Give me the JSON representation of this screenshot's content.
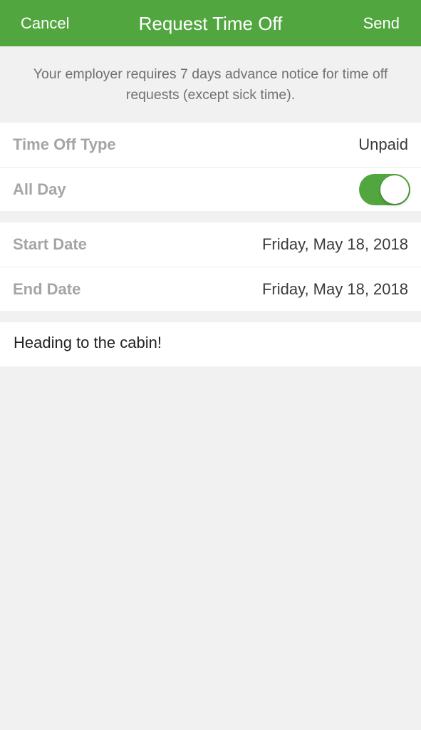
{
  "nav": {
    "cancel_label": "Cancel",
    "title": "Request Time Off",
    "send_label": "Send",
    "background_color": "#52a640"
  },
  "notice": {
    "text": "Your employer requires 7 days advance notice for time off requests (except sick time)."
  },
  "details": {
    "time_off_type": {
      "label": "Time Off Type",
      "value": "Unpaid"
    },
    "all_day": {
      "label": "All Day",
      "toggled_on": true,
      "toggle_color": "#52a640"
    }
  },
  "dates": {
    "start": {
      "label": "Start Date",
      "value": "Friday, May 18, 2018"
    },
    "end": {
      "label": "End Date",
      "value": "Friday, May 18, 2018"
    }
  },
  "note": {
    "value": "Heading to the cabin!"
  }
}
